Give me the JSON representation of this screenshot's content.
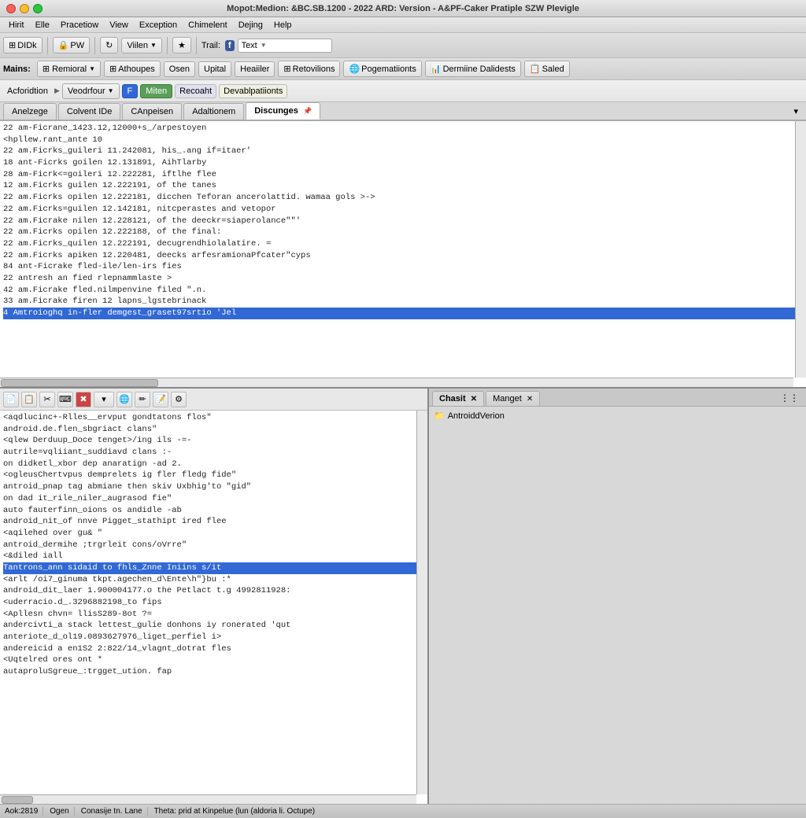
{
  "titleBar": {
    "title": "Mopot:Medion: &BC.SB.1200 - 2022 ARD: Version - A&PF-Caker Pratiple SZW Plevigle"
  },
  "menuBar": {
    "items": [
      "Hirit",
      "Elle",
      "Pracetiow",
      "View",
      "Exception",
      "Chimelent",
      "Dejing",
      "Help"
    ]
  },
  "toolbar1": {
    "btn1": "DIDk",
    "btn2": "PW",
    "dropdown1": "Viilen",
    "dropdown2": "Trail:",
    "textField": "Text"
  },
  "toolbar2": {
    "label": "Mains:",
    "dropdown1": "Remioral",
    "btn1": "Athoupes",
    "btn2": "Osen",
    "btn3": "Upital",
    "btn4": "Heaiiler",
    "btn5": "Retovilions",
    "btn6": "Pogematiionts",
    "btn7": "Dermiine Dalidests",
    "btn8": "Saled"
  },
  "toolbar3": {
    "btn1": "Acforidtion",
    "btn2": "Veodrfour",
    "btn3": "F",
    "btn4": "Miten",
    "btn5": "Recoaht",
    "btn6": "Devablpatiionts"
  },
  "tabs": {
    "items": [
      "Anelzege",
      "Colvent IDe",
      "CAnpeisen",
      "Adaltionem",
      "Discunges"
    ],
    "active": 4
  },
  "logPanel": {
    "lines": [
      "22 am-Ficrane_1423.12,12000+s_/arpestoyen",
      "<hpllew.rant_ante 10",
      "22 am.Ficrks_guileri 11.242081, his_.ang if=itaer'",
      "18 ant-Ficrks goilen 12.131891, AihTlarby",
      "28 am-Ficrk<=goileri 12.222281, iftlhe flee",
      "12 am.Ficrks guilen 12.222191, of the tanes",
      "22 am.Ficrks opilen 12.222181, dicchen Teforan ancerolattid. wamaa gols >->",
      "22 am.Ficrks=guilen 12.142181, nitcperastes and vetopor",
      "22 am.Ficrake nilen 12.228121, of the deeckr=siaperolance\"\"'",
      "22 am.Ficrks opilen 12.222188, of the final:",
      "22 am.Ficrks_quilen 12.222191, decugrendhiolalatire. =",
      "22 am.Ficrks apiken 12.220481, deecks arfesramionaPfcater\"cyps",
      "84 ant-Ficrake fled-ile/len-irs fies",
      "22 antresh an fied rlepnammlaste >",
      "42 am.Ficrake fled.nilmpenvine filed \".n.",
      "33 am.Ficrake firen 12 lapns_lgstebrinack",
      "4 Amtroioghq in-fler demgest_graset97srtio 'Jel"
    ],
    "highlightedLine": 16
  },
  "sourcePanel": {
    "toolbarIcons": [
      "file-icon",
      "copy-icon",
      "cut-icon",
      "terminal-icon",
      "delete-icon",
      "dropdown-icon",
      "globe-icon",
      "pencil-icon",
      "doc-icon",
      "flow-icon"
    ],
    "lines": [
      "<aqdlucinc+-Rlles__ervput gondtatons flos\"",
      "    android.de.flen_sbgriact clans\"",
      "<qlew Derduup_Doce tenget>/ing ils -=-",
      "    autrile=vqliiant_suddiavd clans :-",
      "    on didketl_xbor dep anaratign -ad 2.",
      "<ogleusChertvpus demprelets ig fler fledg fide\"",
      "    antroid_pnap tag abmiane then skiv Uxbhig'to \"gid\"",
      "    on dad it_rile_niler_augrasod fie\"",
      "    auto fauterfinn_oions os andidle -ab",
      "    android_nit_of nnve Pigget_stathipt ired flee",
      "<aqilehed over gu& \"",
      "    antroid_dermihe ;trgrleit cons/oVrre\"",
      "<&diled iall",
      "Tantrons_ann sidaid to fhls_Znne Iniins s/it",
      "<arlt /oi7_ginuma tkpt.agechen_d\\Ente\\h\"}bu :*",
      "    android_dit_laer 1.900004177.o the Petlact t.g 4992811928:",
      "    <uderracio.d_.3296882198_to fips",
      "<Apllesn chvn= llisS289-8ot ?=",
      "    andercivti_a stack lettest_gulie donhons iy ronerated 'qut",
      "    anteriote_d_ol19.0893627976_liget_perfiel i>",
      "    andereicid a en1S2 2:822/14_vlagnt_dotrat fles",
      "<Uqtelred ores ont *",
      "    autaproluSgreue_:trgget_ution. fap"
    ],
    "highlightedLine": 13
  },
  "rightPanel": {
    "tabs": [
      "Chasit",
      "Manget"
    ],
    "activeTab": 0,
    "treeItem": "AntroiddVerion"
  },
  "statusBar": {
    "seg1": "Aok:2819",
    "seg2": "Ogen",
    "seg3": "Conasije tn. Lane",
    "seg4": "Theta: prid at Kinpelue (lun (aldoria li. Octupe)"
  }
}
